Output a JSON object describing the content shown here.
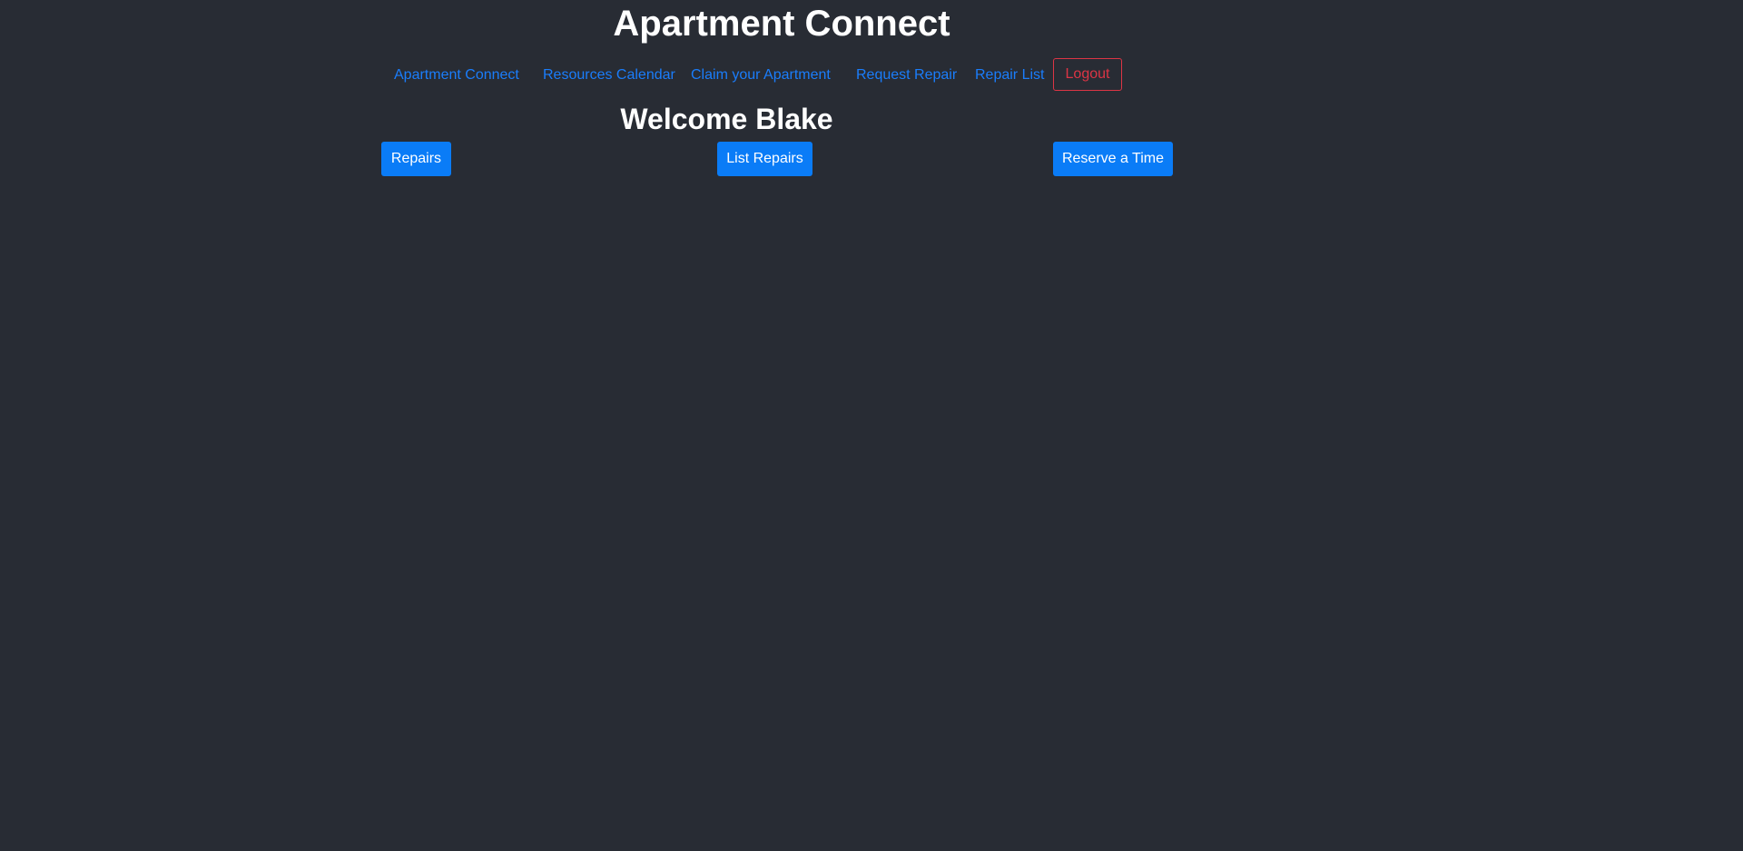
{
  "header": {
    "title": "Apartment Connect"
  },
  "nav": {
    "items": [
      {
        "label": "Apartment Connect"
      },
      {
        "label": "Resources Calendar"
      },
      {
        "label": "Claim your Apartment"
      },
      {
        "label": "Request Repair"
      },
      {
        "label": "Repair List"
      }
    ],
    "logout_label": "Logout"
  },
  "main": {
    "welcome": "Welcome Blake",
    "actions": [
      {
        "label": "Repairs"
      },
      {
        "label": "List Repairs"
      },
      {
        "label": "Reserve a Time"
      }
    ]
  },
  "colors": {
    "background": "#282c34",
    "link": "#1a7dfb",
    "primary_button": "#0a7cf7",
    "danger": "#dc3545",
    "text": "#ffffff"
  }
}
